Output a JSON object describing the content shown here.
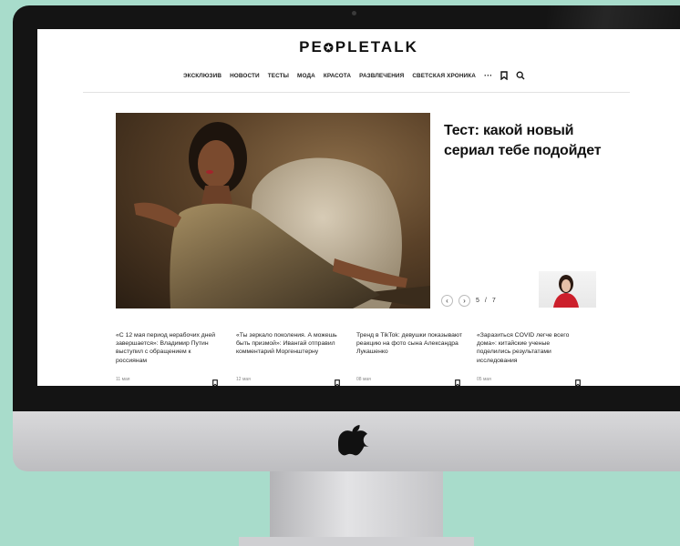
{
  "site": {
    "logo_left": "PE",
    "logo_right": "PLETALK"
  },
  "nav": {
    "items": [
      "ЭКСКЛЮЗИВ",
      "НОВОСТИ",
      "ТЕСТЫ",
      "МОДА",
      "КРАСОТА",
      "РАЗВЛЕЧЕНИЯ",
      "СВЕТСКАЯ ХРОНИКА"
    ],
    "more": "···",
    "icons": [
      "bookmark-icon",
      "search-icon"
    ]
  },
  "hero": {
    "headline": "Тест: какой новый сериал тебе подойдет",
    "pager": {
      "current": "5",
      "separator": "/",
      "total": "7"
    }
  },
  "cards": [
    {
      "title": "«С 12 мая период нерабочих дней завершается»: Владимир Путин выступил с обращением к россиянам",
      "date": "11 мая"
    },
    {
      "title": "«Ты зеркало поколения. А можешь быть призмой»: Ивангай отправил комментарий Моргенштерну",
      "date": "12 мая"
    },
    {
      "title": "Тренд в TikTok: девушки показывают реакцию на фото сына Александра Лукашенко",
      "date": "08 мая"
    },
    {
      "title": "«Заразиться COVID легче всего дома»: китайские ученые поделились результатами исследования",
      "date": "05 мая"
    }
  ],
  "colors": {
    "background": "#a8dccb",
    "bezel": "#141414",
    "accent": "#cc1f2b"
  }
}
